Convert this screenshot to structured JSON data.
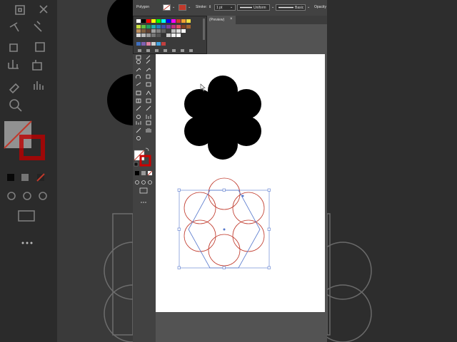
{
  "control_bar": {
    "object_type": "Polygon",
    "stroke_label": "Stroke:",
    "stroke_weight": "1 pt",
    "profile_label": "Uniform",
    "brush_label": "Basic",
    "opacity_label": "Opacity"
  },
  "document_tab": {
    "title": "(Preview)",
    "close_glyph": "×"
  },
  "colors": {
    "fill": "#000000",
    "stroke_path": "#c0392b",
    "selection": "#4a6fd4",
    "ui_dark": "#424242",
    "ui_mid": "#535353",
    "artboard": "#ffffff"
  },
  "icons": [
    "selection-tool-icon",
    "direct-selection-tool-icon",
    "pen-tool-icon",
    "curvature-tool-icon",
    "type-tool-icon",
    "line-tool-icon",
    "rectangle-tool-icon",
    "paintbrush-tool-icon",
    "shaper-tool-icon",
    "eraser-tool-icon",
    "rotate-tool-icon",
    "scale-tool-icon",
    "warp-tool-icon",
    "free-transform-tool-icon",
    "shape-builder-tool-icon",
    "perspective-tool-icon",
    "mesh-tool-icon",
    "gradient-tool-icon",
    "eyedropper-tool-icon",
    "blend-tool-icon",
    "symbol-sprayer-tool-icon",
    "column-graph-tool-icon",
    "artboard-tool-icon",
    "slice-tool-icon",
    "hand-tool-icon",
    "zoom-tool-icon"
  ]
}
